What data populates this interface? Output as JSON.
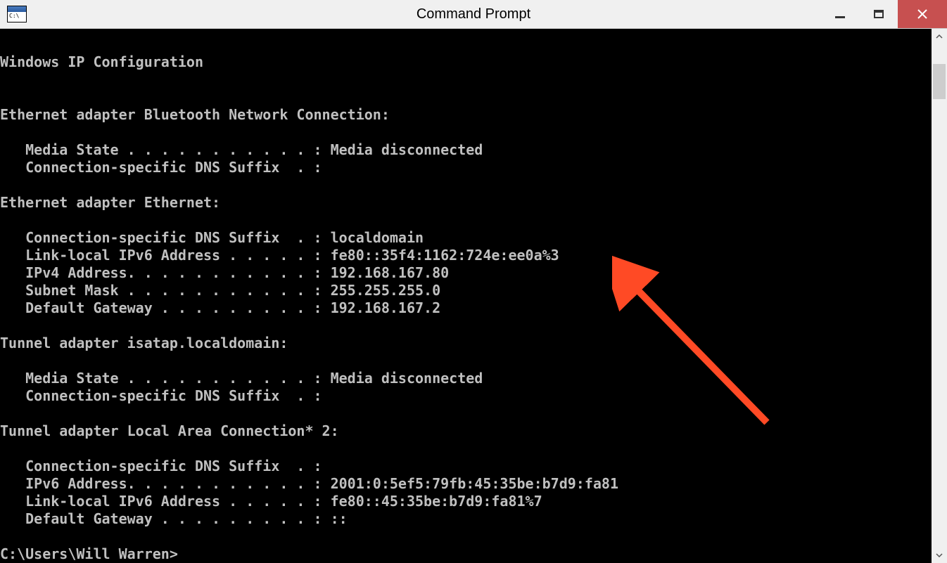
{
  "window": {
    "title": "Command Prompt"
  },
  "terminal": {
    "lines": [
      "",
      "Windows IP Configuration",
      "",
      "",
      "Ethernet adapter Bluetooth Network Connection:",
      "",
      "   Media State . . . . . . . . . . . : Media disconnected",
      "   Connection-specific DNS Suffix  . :",
      "",
      "Ethernet adapter Ethernet:",
      "",
      "   Connection-specific DNS Suffix  . : localdomain",
      "   Link-local IPv6 Address . . . . . : fe80::35f4:1162:724e:ee0a%3",
      "   IPv4 Address. . . . . . . . . . . : 192.168.167.80",
      "   Subnet Mask . . . . . . . . . . . : 255.255.255.0",
      "   Default Gateway . . . . . . . . . : 192.168.167.2",
      "",
      "Tunnel adapter isatap.localdomain:",
      "",
      "   Media State . . . . . . . . . . . : Media disconnected",
      "   Connection-specific DNS Suffix  . :",
      "",
      "Tunnel adapter Local Area Connection* 2:",
      "",
      "   Connection-specific DNS Suffix  . :",
      "   IPv6 Address. . . . . . . . . . . : 2001:0:5ef5:79fb:45:35be:b7d9:fa81",
      "   Link-local IPv6 Address . . . . . : fe80::45:35be:b7d9:fa81%7",
      "   Default Gateway . . . . . . . . . : ::",
      "",
      "C:\\Users\\Will Warren>"
    ]
  },
  "annotation": {
    "color": "#ff4a25"
  }
}
